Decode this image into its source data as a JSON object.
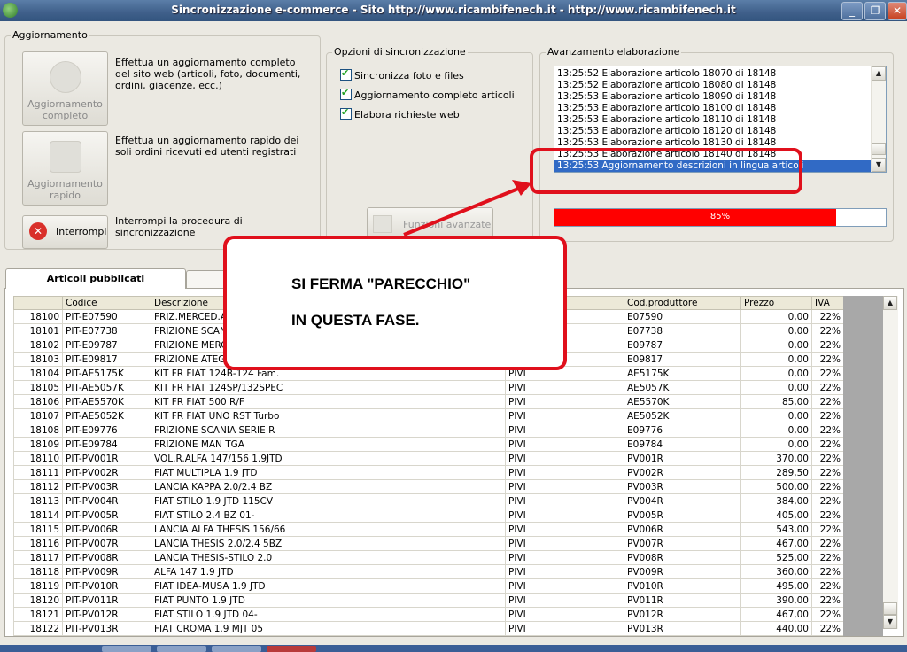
{
  "window": {
    "title": "Sincronizzazione e-commerce - Sito http://www.ricambifenech.it - http://www.ricambifenech.it"
  },
  "aggiornamento": {
    "legend": "Aggiornamento",
    "btn_completo": "Aggiornamento completo",
    "desc_completo": "Effettua un aggiornamento completo del sito web (articoli, foto, documenti, ordini, giacenze, ecc.)",
    "btn_rapido": "Aggiornamento rapido",
    "desc_rapido": "Effettua un aggiornamento rapido dei soli ordini ricevuti ed utenti registrati",
    "btn_interrompi": "Interrompi",
    "desc_interrompi": "Interrompi la procedura di sincronizzazione"
  },
  "opzioni": {
    "legend": "Opzioni di sincronizzazione",
    "checks": [
      "Sincronizza foto e files",
      "Aggiornamento completo articoli",
      "Elabora richieste web"
    ],
    "btn_avanzate": "Funzioni avanzate"
  },
  "avanzamento": {
    "legend": "Avanzamento elaborazione",
    "log": [
      "13:25:52 Elaborazione articolo 18070 di 18148",
      "13:25:52 Elaborazione articolo 18080 di 18148",
      "13:25:53 Elaborazione articolo 18090 di 18148",
      "13:25:53 Elaborazione articolo 18100 di 18148",
      "13:25:53 Elaborazione articolo 18110 di 18148",
      "13:25:53 Elaborazione articolo 18120 di 18148",
      "13:25:53 Elaborazione articolo 18130 di 18148",
      "13:25:53 Elaborazione articolo 18140 di 18148",
      "13:25:53 Aggiornamento descrizioni in lingua articoli"
    ],
    "progress_value": 0.85,
    "progress_label": "85%"
  },
  "tabs": {
    "active": "Articoli pubblicati"
  },
  "table": {
    "columns": [
      "",
      "Codice",
      "Descrizione",
      "",
      "Cod.produttore",
      "Prezzo",
      "IVA"
    ],
    "rows": [
      [
        "18100",
        "PIT-E07590",
        "FRIZ.MERCED.A",
        "",
        "E07590",
        "0,00",
        "22%"
      ],
      [
        "18101",
        "PIT-E07738",
        "FRIZIONE SCANI",
        "",
        "E07738",
        "0,00",
        "22%"
      ],
      [
        "18102",
        "PIT-E09787",
        "FRIZIONE MERC",
        "",
        "E09787",
        "0,00",
        "22%"
      ],
      [
        "18103",
        "PIT-E09817",
        "FRIZIONE ATEGO",
        "",
        "E09817",
        "0,00",
        "22%"
      ],
      [
        "18104",
        "PIT-AE5175K",
        "KIT FR FIAT 124B-124 Fam.",
        "PIVI",
        "AE5175K",
        "0,00",
        "22%"
      ],
      [
        "18105",
        "PIT-AE5057K",
        "KIT FR FIAT 124SP/132SPEC",
        "PIVI",
        "AE5057K",
        "0,00",
        "22%"
      ],
      [
        "18106",
        "PIT-AE5570K",
        "KIT FR FIAT 500 R/F",
        "PIVI",
        "AE5570K",
        "85,00",
        "22%"
      ],
      [
        "18107",
        "PIT-AE5052K",
        "KIT FR FIAT UNO RST Turbo",
        "PIVI",
        "AE5052K",
        "0,00",
        "22%"
      ],
      [
        "18108",
        "PIT-E09776",
        "FRIZIONE SCANIA SERIE R",
        "PIVI",
        "E09776",
        "0,00",
        "22%"
      ],
      [
        "18109",
        "PIT-E09784",
        "FRIZIONE MAN TGA",
        "PIVI",
        "E09784",
        "0,00",
        "22%"
      ],
      [
        "18110",
        "PIT-PV001R",
        "VOL.R.ALFA 147/156 1.9JTD",
        "PIVI",
        "PV001R",
        "370,00",
        "22%"
      ],
      [
        "18111",
        "PIT-PV002R",
        "FIAT MULTIPLA 1.9 JTD",
        "PIVI",
        "PV002R",
        "289,50",
        "22%"
      ],
      [
        "18112",
        "PIT-PV003R",
        "LANCIA KAPPA 2.0/2.4 BZ",
        "PIVI",
        "PV003R",
        "500,00",
        "22%"
      ],
      [
        "18113",
        "PIT-PV004R",
        "FIAT STILO 1.9 JTD 115CV",
        "PIVI",
        "PV004R",
        "384,00",
        "22%"
      ],
      [
        "18114",
        "PIT-PV005R",
        "FIAT STILO 2.4 BZ 01-",
        "PIVI",
        "PV005R",
        "405,00",
        "22%"
      ],
      [
        "18115",
        "PIT-PV006R",
        "LANCIA ALFA THESIS 156/66",
        "PIVI",
        "PV006R",
        "543,00",
        "22%"
      ],
      [
        "18116",
        "PIT-PV007R",
        "LANCIA THESIS 2.0/2.4 5BZ",
        "PIVI",
        "PV007R",
        "467,00",
        "22%"
      ],
      [
        "18117",
        "PIT-PV008R",
        "LANCIA THESIS-STILO 2.0",
        "PIVI",
        "PV008R",
        "525,00",
        "22%"
      ],
      [
        "18118",
        "PIT-PV009R",
        "ALFA 147 1.9 JTD",
        "PIVI",
        "PV009R",
        "360,00",
        "22%"
      ],
      [
        "18119",
        "PIT-PV010R",
        "FIAT IDEA-MUSA 1.9 JTD",
        "PIVI",
        "PV010R",
        "495,00",
        "22%"
      ],
      [
        "18120",
        "PIT-PV011R",
        "FIAT PUNTO 1.9 JTD",
        "PIVI",
        "PV011R",
        "390,00",
        "22%"
      ],
      [
        "18121",
        "PIT-PV012R",
        "FIAT STILO 1.9 JTD 04-",
        "PIVI",
        "PV012R",
        "467,00",
        "22%"
      ],
      [
        "18122",
        "PIT-PV013R",
        "FIAT CROMA 1.9 MJT 05",
        "PIVI",
        "PV013R",
        "440,00",
        "22%"
      ]
    ]
  },
  "callout": {
    "line1": "SI FERMA \"PARECCHIO\"",
    "line2": "IN QUESTA FASE."
  }
}
